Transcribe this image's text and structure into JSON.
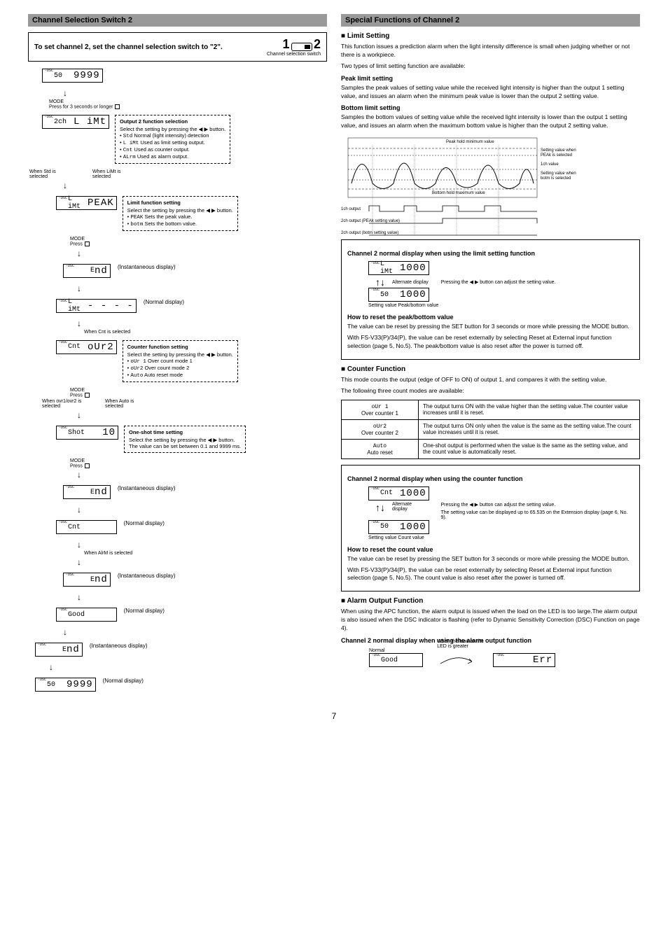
{
  "left": {
    "header": "Channel Selection Switch 2",
    "instruction": "To set channel 2, set the channel selection switch to \"2\".",
    "switch_label": "Channel selection switch",
    "switch_1": "1",
    "switch_2": "2",
    "disp_initial_small": "50",
    "disp_initial_main": "9999",
    "press_mode_3s": "Press      for 3 seconds or longer",
    "mode_lbl": "MODE",
    "disp_2ch_small": "2ch",
    "disp_2ch_main": "L iMt",
    "out2": {
      "title": "Output 2 function selection",
      "line1": "Select the setting by pressing the ◀ ▶ button.",
      "i1a": "Std",
      "i1b": "Normal (light intensity) detection",
      "i2a": "L iMt",
      "i2b": "Used as limit setting output.",
      "i3a": "Cnt",
      "i3b": "Used as counter output.",
      "i4a": "ALrm",
      "i4b": "Used as alarm output."
    },
    "when_std": "When Std is selected",
    "when_limt": "When LiMt is selected",
    "disp_limt_small": "L iMt",
    "disp_limt_main": "PEAK",
    "limit_fn": {
      "title": "Limit function setting",
      "line1": "Select the setting by pressing the ◀ ▶ button.",
      "i1a": "PEAK",
      "i1b": "Sets the peak value.",
      "i2a": "botm",
      "i2b": "Sets the bottom value."
    },
    "press_mode": "Press",
    "end_small": "E",
    "end_main": "nd",
    "instant": "(Instantaneous display)",
    "normal_disp": "(Normal display)",
    "disp_limt2_small": "L iMt",
    "disp_limt2_main": "- - - -",
    "when_cnt": "When Cnt is selected",
    "disp_cnt_small": "Cnt",
    "disp_cnt_main": "oUr2",
    "counter_fn": {
      "title": "Counter function setting",
      "line1": "Select the setting by pressing the ◀ ▶ button.",
      "i1a": "oUr 1",
      "i1b": "Over count mode 1",
      "i2a": "oUr2",
      "i2b": "Over count mode 2",
      "i3a": "Auto",
      "i3b": "Auto reset mode"
    },
    "when_ovr": "When ovr1/ovr2 is selected",
    "when_auto": "When Auto is selected",
    "disp_shot_small": "Shot",
    "disp_shot_main": "10",
    "oneshot": {
      "title": "One-shot time setting",
      "line1": "Select the setting by pressing the ◀ ▶ button.",
      "line2": "The value can be set between 0.1 and 9999 ms."
    },
    "disp_cnt2_small": "Cnt",
    "when_alrm": "When AlrM is selected",
    "disp_good_small": "Good",
    "disp_end2_small": "E",
    "disp_end2_main": "nd",
    "disp_final_small": "50",
    "disp_final_main": "9999"
  },
  "right": {
    "header": "Special Functions of Channel 2",
    "limit_title": "■  Limit Setting",
    "limit_p1": "This function issues a prediction alarm when the light intensity difference is small when judging whether or not there is a workpiece.",
    "limit_p2": "Two types of limit setting function are available:",
    "peak_title": "Peak limit setting",
    "peak_p": "Samples the peak values of setting value while the received light intensity is higher than the output 1 setting value, and issues an alarm when the minimum peak value is lower than the output 2 setting value.",
    "bottom_title": "Bottom limit setting",
    "bottom_p": "Samples the bottom values of setting value while the received light intensity is lower than the output 1 setting value, and issues an alarm when the maximum bottom value is higher than the output 2 setting value.",
    "graph": {
      "peak_hold_min": "Peak hold minimum value",
      "sv_peak": "Setting value when PEAk is selected",
      "ch1": "1ch value",
      "sv_botm": "Setting value when botm is selected",
      "bottom_hold_max": "Bottom hold maximum value",
      "out1": "1ch output",
      "out2": "2ch output (PEAk setting value)",
      "out3": "2ch output (botm setting value)"
    },
    "box1_title": "Channel 2 normal display when using the limit setting function",
    "box1_disp1_small": "L iMt",
    "box1_disp1_main": "1000",
    "box1_alt": "Alternate display",
    "box1_press": "Pressing the ◀ ▶ button can adjust the setting value.",
    "box1_disp2_small": "50",
    "box1_disp2_main": "1000",
    "box1_lbl": "Setting value   Peak/bottom value",
    "box1_reset_title": "How to reset the peak/bottom value",
    "box1_reset_p1": "The value can be reset by pressing the SET button for 3 seconds or more while pressing the MODE button.",
    "box1_reset_p2": "With FS-V33(P)/34(P), the value can be reset externally by selecting Reset at External input function selection (page 5, No.5). The peak/bottom value is also reset after the power is turned off.",
    "counter_title": "■  Counter Function",
    "counter_p1": "This mode counts the output (edge of OFF to ON) of output 1, and compares it with the setting value.",
    "counter_p2": "The following three count modes are available:",
    "modes": {
      "r1a": "oUr 1",
      "r1b": "Over counter 1",
      "r1c": "The output turns ON with the value higher than the setting value.The counter value increases until it is reset.",
      "r2a": "oUr2",
      "r2b": "Over counter 2",
      "r2c": "The output turns ON only when the value is the same as the setting value.The count value increases until it is reset.",
      "r3a": "Auto",
      "r3b": "Auto reset",
      "r3c": "One-shot output is performed when the value is the same as the setting value, and the count value is automatically reset."
    },
    "box2_title": "Channel 2 normal display when using the counter function",
    "box2_disp1_small": "Cnt",
    "box2_disp1_main": "1000",
    "box2_press": "Pressing the ◀ ▶ button can adjust the setting value.",
    "box2_note": "The setting value can be displayed up to 65.535 on the Extension display (page 6, No. 9).",
    "box2_disp2_small": "50",
    "box2_disp2_main": "1000",
    "box2_lbl": "Setting value    Count value",
    "box2_reset_title": "How to reset the count value",
    "box2_reset_p1": "The value can be reset by pressing the SET button for 3 seconds or more while pressing the MODE button.",
    "box2_reset_p2": "With FS-V33(P)/34(P), the value can be reset externally by selecting Reset at External input function selection (page 5, No.5). The count value is also reset after the power is turned off.",
    "alarm_title": "■  Alarm Output Function",
    "alarm_p": "When using the APC function, the alarm output is issued when the load on the LED is too large.The alarm output is also issued when the DSC indicator is flashing (refer to Dynamic Sensitivity Correction (DSC) Function on page 4).",
    "alarm_box_title": "Channel 2 normal display when using the alarm output function",
    "alarm_normal": "Normal",
    "alarm_when": "When the load on the LED is greater",
    "alarm_good": "Good",
    "alarm_err": "Err"
  },
  "page_num": "7"
}
